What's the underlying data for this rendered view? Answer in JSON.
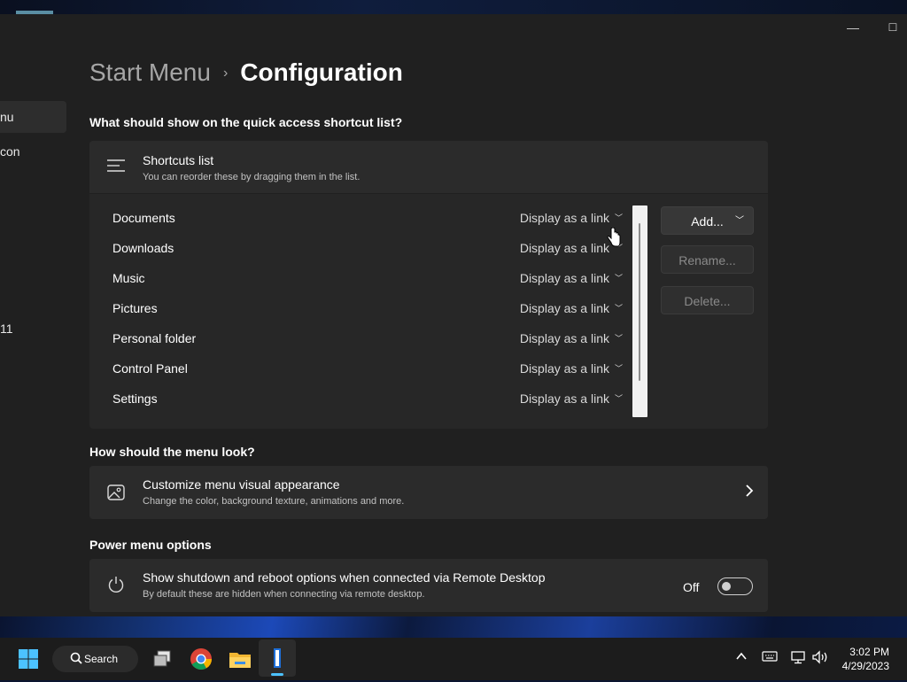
{
  "sidebar": {
    "items": [
      {
        "label": "nu",
        "selected": true
      },
      {
        "label": "con",
        "selected": false
      },
      {
        "label": "11",
        "selected": false
      }
    ]
  },
  "breadcrumb": {
    "parent": "Start Menu",
    "separator": "›",
    "current": "Configuration"
  },
  "sections": {
    "quick_access_heading": "What should show on the quick access shortcut list?",
    "look_heading": "How should the menu look?",
    "power_heading": "Power menu options"
  },
  "shortcuts_card": {
    "icon": "list-icon",
    "title": "Shortcuts list",
    "subtitle": "You can reorder these by dragging them in the list."
  },
  "shortcuts": [
    {
      "name": "Documents",
      "option": "Display as a link"
    },
    {
      "name": "Downloads",
      "option": "Display as a link"
    },
    {
      "name": "Music",
      "option": "Display as a link"
    },
    {
      "name": "Pictures",
      "option": "Display as a link"
    },
    {
      "name": "Personal folder",
      "option": "Display as a link"
    },
    {
      "name": "Control Panel",
      "option": "Display as a link"
    },
    {
      "name": "Settings",
      "option": "Display as a link"
    }
  ],
  "buttons": {
    "add": "Add...",
    "rename": "Rename...",
    "delete": "Delete..."
  },
  "appearance_card": {
    "icon": "image-icon",
    "title": "Customize menu visual appearance",
    "subtitle": "Change the color, background texture, animations and more."
  },
  "power_card": {
    "icon": "power-icon",
    "title": "Show shutdown and reboot options when connected via Remote Desktop",
    "subtitle": "By default these are hidden when connecting via remote desktop.",
    "toggle_label": "Off",
    "toggle_on": false
  },
  "taskbar": {
    "search_label": "Search",
    "time": "3:02 PM",
    "date": "4/29/2023",
    "apps": [
      "windows-start-icon",
      "task-view-icon",
      "chrome-icon",
      "file-explorer-icon",
      "start11-icon"
    ]
  },
  "colors": {
    "window_bg": "#202020",
    "card_bg": "#2b2b2b",
    "accent": "#4cc2ff"
  }
}
